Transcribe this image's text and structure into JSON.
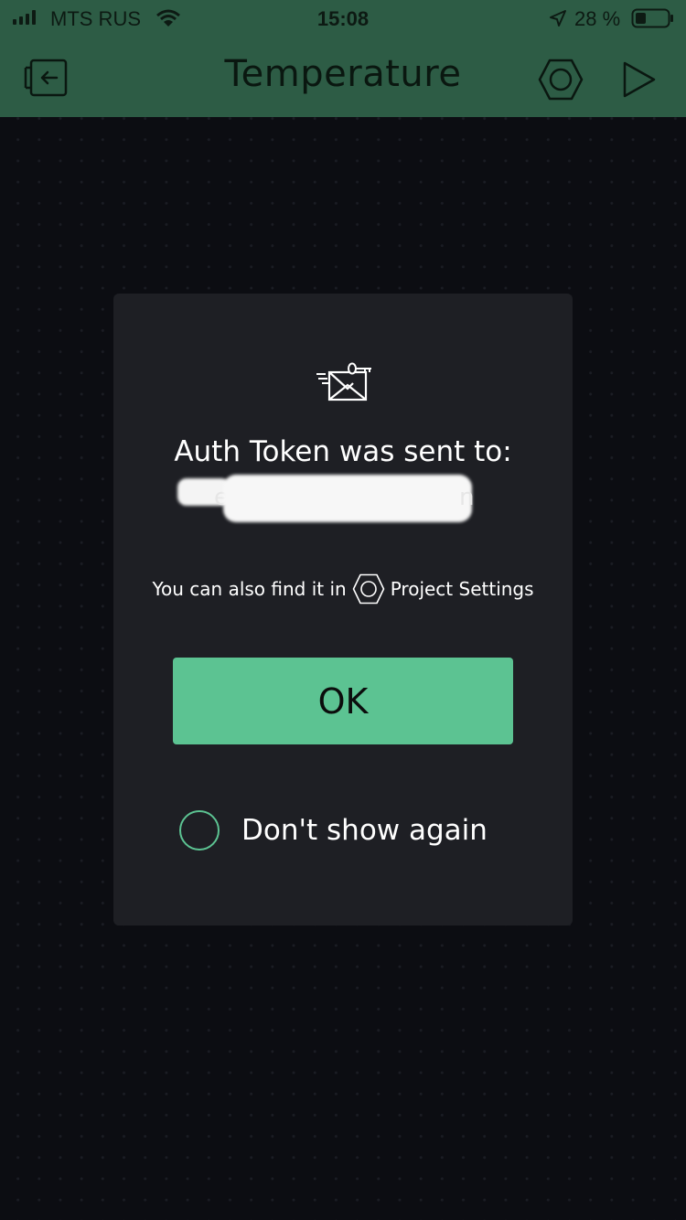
{
  "status_bar": {
    "carrier": "MTS RUS",
    "time": "15:08",
    "battery_percent": "28 %"
  },
  "app_bar": {
    "title": "Temperature",
    "icons": [
      "exit-icon",
      "hexagon-settings-icon",
      "play-icon"
    ]
  },
  "dialog": {
    "icon": "mail-key-icon",
    "title": "Auth Token was sent to:",
    "email_visible_fragments": [
      "e",
      "n"
    ],
    "hint_prefix": "You can also find it in",
    "hint_icon": "hexagon-settings-icon",
    "hint_suffix": "Project Settings",
    "ok_label": "OK",
    "dont_show_label": "Don't show again",
    "dont_show_checked": false
  },
  "colors": {
    "app_bar": "#2d5c45",
    "background": "#0c0d12",
    "dialog": "#1e1f24",
    "accent": "#5cc392"
  }
}
